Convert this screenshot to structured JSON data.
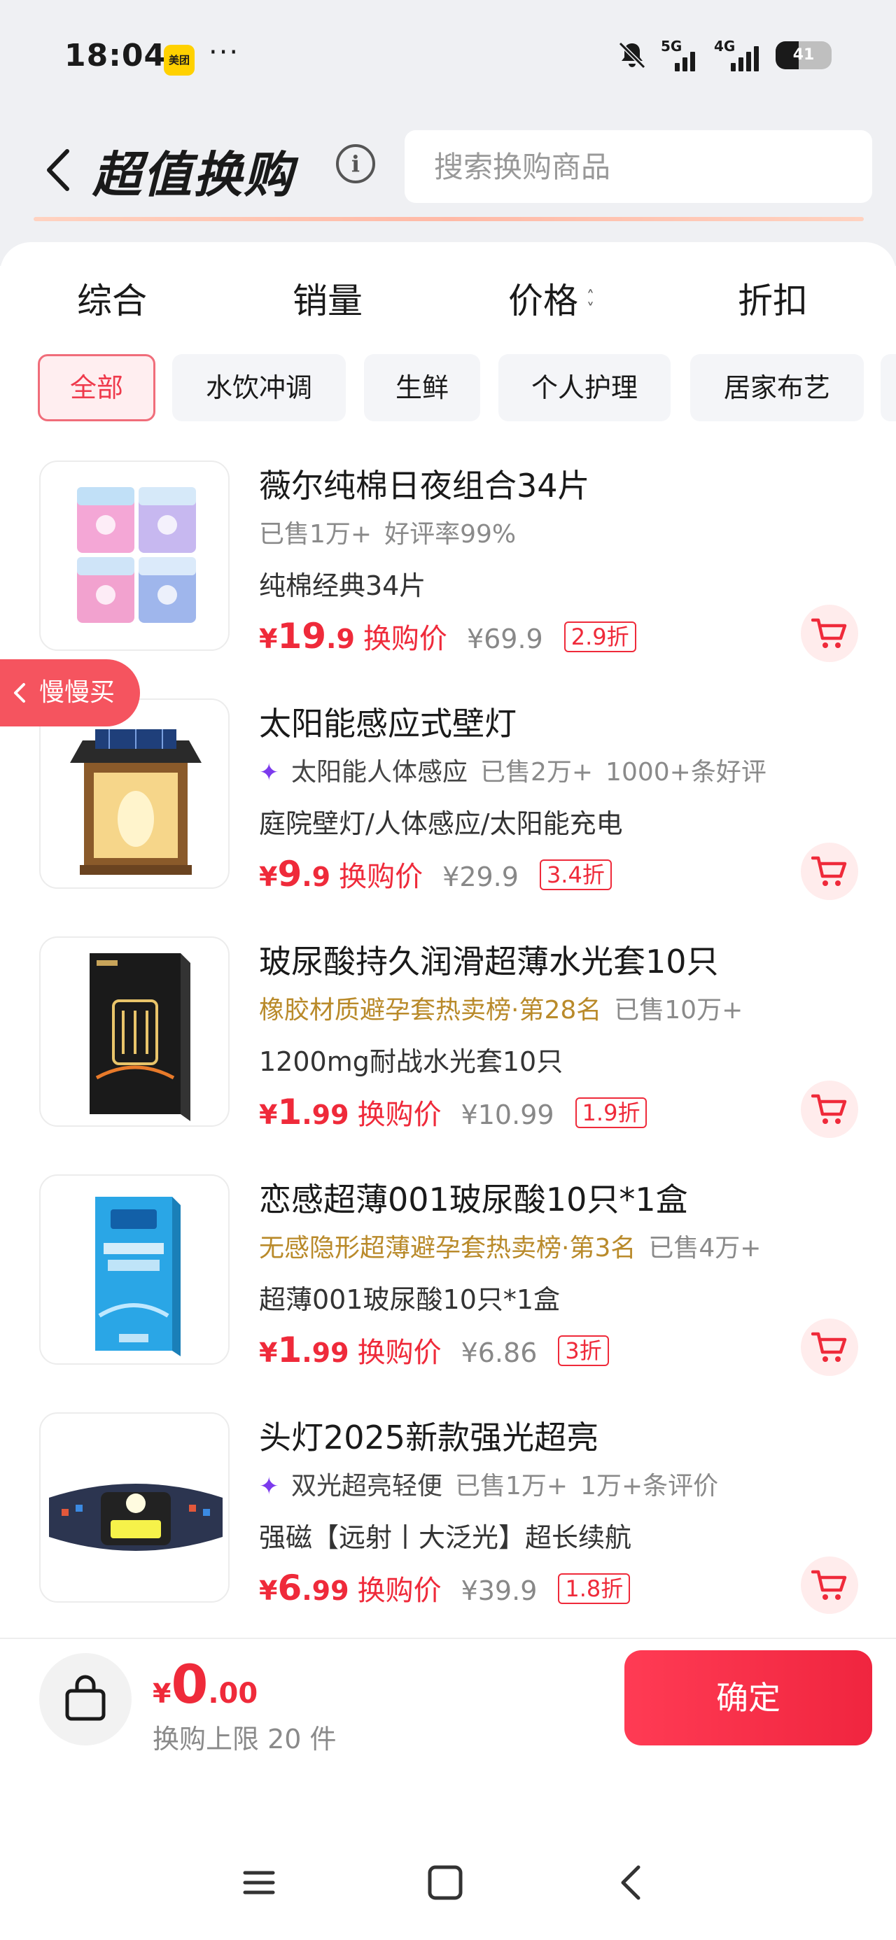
{
  "status_bar": {
    "time": "18:04",
    "app_badge": "美团",
    "more": "···",
    "network_1": "5G",
    "network_2": "4G",
    "battery": "41"
  },
  "header": {
    "title": "超值换购",
    "info": "i",
    "search_placeholder": "搜索换购商品"
  },
  "sort_tabs": [
    "综合",
    "销量",
    "价格",
    "折扣"
  ],
  "categories": [
    "全部",
    "水饮冲调",
    "生鲜",
    "个人护理",
    "居家布艺"
  ],
  "products": [
    {
      "title": "薇尔纯棉日夜组合34片",
      "meta": [
        "已售1万+",
        "好评率99%"
      ],
      "desc": "纯棉经典34片",
      "yen": "¥",
      "price_int": "19",
      "price_frac": ".9",
      "price_label": "换购价",
      "original": "¥69.9",
      "discount": "2.9折"
    },
    {
      "title": "太阳能感应式壁灯",
      "meta_highlight": "太阳能人体感应",
      "meta": [
        "已售2万+",
        "1000+条好评"
      ],
      "desc": "庭院壁灯/人体感应/太阳能充电",
      "yen": "¥",
      "price_int": "9",
      "price_frac": ".9",
      "price_label": "换购价",
      "original": "¥29.9",
      "discount": "3.4折"
    },
    {
      "title": "玻尿酸持久润滑超薄水光套10只",
      "meta_rank": "橡胶材质避孕套热卖榜·第28名",
      "meta": [
        "已售10万+"
      ],
      "desc": "1200mg耐战水光套10只",
      "yen": "¥",
      "price_int": "1",
      "price_frac": ".99",
      "price_label": "换购价",
      "original": "¥10.99",
      "discount": "1.9折"
    },
    {
      "title": "恋感超薄001玻尿酸10只*1盒",
      "meta_rank": "无感隐形超薄避孕套热卖榜·第3名",
      "meta": [
        "已售4万+"
      ],
      "desc": "超薄001玻尿酸10只*1盒",
      "yen": "¥",
      "price_int": "1",
      "price_frac": ".99",
      "price_label": "换购价",
      "original": "¥6.86",
      "discount": "3折"
    },
    {
      "title": "头灯2025新款强光超亮",
      "meta_highlight": "双光超亮轻便",
      "meta": [
        "已售1万+",
        "1万+条评价"
      ],
      "desc": "强磁【远射丨大泛光】超长续航",
      "yen": "¥",
      "price_int": "6",
      "price_frac": ".99",
      "price_label": "换购价",
      "original": "¥39.9",
      "discount": "1.8折"
    }
  ],
  "float_tag": "慢慢买",
  "bottom": {
    "yen": "¥",
    "total_int": "0",
    "total_dec": ".00",
    "limit": "换购上限 20 件",
    "confirm": "确定"
  },
  "colors": {
    "accent_red": "#ef2a3a",
    "rank_gold": "#b98a2a",
    "highlight_purple": "#7c3aed",
    "float_tag": "#f5545f"
  }
}
